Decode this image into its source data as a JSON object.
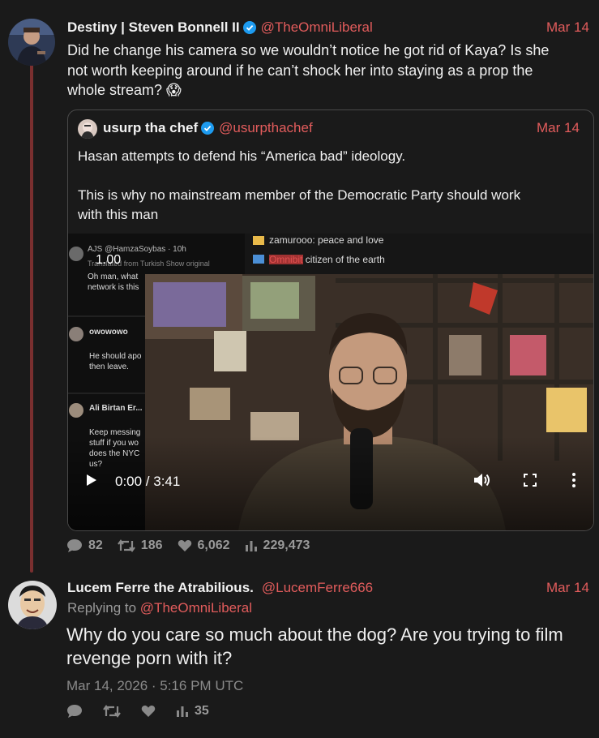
{
  "tweet1": {
    "name": "Destiny | Steven Bonnell II",
    "handle": "@TheOmniLiberal",
    "date": "Mar 14",
    "text_line1": "Did he change his camera so we wouldn’t notice he got rid of Kaya? Is she",
    "text_line2": "not worth keeping around if he can’t shock her into staying as a prop the",
    "text_line3": "whole stream? 😱",
    "stats": {
      "replies": "82",
      "retweets": "186",
      "likes": "6,062",
      "views": "229,473"
    }
  },
  "quote": {
    "name": "usurp tha chef",
    "handle": "@usurpthachef",
    "date": "Mar 14",
    "text_line1": "Hasan attempts to defend his “America bad” ideology.",
    "text_line2": "This is why no mainstream member of the Democratic Party should work",
    "text_line3": "with this man",
    "video": {
      "speed": "1.00",
      "time": "0:00 / 3:41",
      "chat1": "zamurooo: peace and love",
      "chat2": "citizen of the earth",
      "chat2_user": "Omnibit",
      "side1_user": "AJS @HamzaSoybas · 10h",
      "side1_sub": "Translated from Turkish Show original",
      "side1_text": "Oh man, what",
      "side1_text2": "network is this",
      "side2_user": "owowowo",
      "side2_text": "He should apo",
      "side2_text2": "then leave.",
      "side3_user": "Ali Birtan Er...",
      "side3_text": "Keep messing",
      "side3_text2": "stuff if you wo",
      "side3_text3": "does the NYC",
      "side3_text4": "us?"
    }
  },
  "tweet2": {
    "name": "Lucem Ferre the Atrabilious.",
    "handle": "@LucemFerre666",
    "date": "Mar 14",
    "replying_prefix": "Replying to",
    "replying_handle": "@TheOmniLiberal",
    "text_line1": "Why do you care so much about the dog? Are you trying to film",
    "text_line2": "revenge porn with it?",
    "timestamp": "Mar 14, 2026 · 5:16 PM UTC",
    "stats": {
      "views": "35"
    }
  },
  "colors": {
    "accent": "#e25c5c",
    "background": "#1a1a1a",
    "verified": "#1d9bf0"
  },
  "icons": [
    "reply-icon",
    "retweet-icon",
    "heart-icon",
    "views-icon",
    "play-icon",
    "volume-icon",
    "fullscreen-icon",
    "more-icon",
    "verified-icon"
  ]
}
